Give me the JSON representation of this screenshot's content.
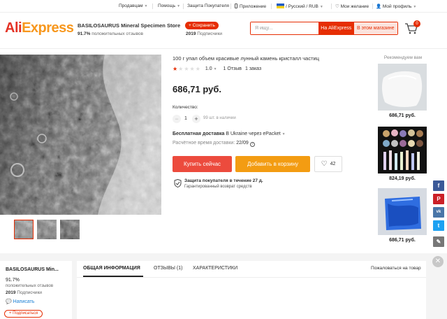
{
  "topbar": {
    "sellers": "Продавцам",
    "help": "Помощь",
    "buyer_protection": "Защита Покупателя",
    "app": "Приложение",
    "locale": "/ Русский / RUB",
    "wishlist": "Мои желание",
    "profile": "Мой профиль"
  },
  "header": {
    "logo_part1": "Ali",
    "logo_part2": "Express",
    "store_name": "BASILOSAURUS Mineral Specimen Store",
    "store_rating": "91.7%",
    "store_rating_label": "положительных отзывов",
    "save_button": "+ Сохранить",
    "subscribers_count": "2019",
    "subscribers_label": "Подписчики",
    "search_placeholder": "Я ищу...",
    "search_aliexpress": "На AliExpress",
    "search_store": "В этом магазине",
    "cart_count": "0"
  },
  "product": {
    "title": "100 г упал объем красивые лунный камень кристалл частиц",
    "rating_value": "1.0",
    "rating_stars": 1,
    "reviews": "1 Отзыв",
    "orders": "1 заказ",
    "price": "686,71 руб.",
    "quantity_label": "Количество:",
    "quantity": "1",
    "availability": "99 шт. в наличии",
    "shipping_bold": "Бесплатная доставка",
    "shipping_rest": " В Ukraine через ePacket",
    "delivery_label": "Расчётное время доставки:",
    "delivery_date": "22/09",
    "buy_now": "Купить сейчас",
    "add_to_cart": "Добавить в корзину",
    "wishlist_count": "42",
    "protection_title": "Защита покупателя в течение 27 д.",
    "protection_subtitle": "Гарантированный возврат средств"
  },
  "recommendations": {
    "title": "Рекомендуем вам",
    "items": [
      {
        "price": "686,71 руб."
      },
      {
        "price": "824,19 руб."
      },
      {
        "price": "686,71 руб."
      }
    ]
  },
  "share": {
    "facebook": "f",
    "pinterest": "P",
    "vk": "vk",
    "twitter": "t",
    "edit": "✎",
    "facebook_color": "#3b5998",
    "pinterest_color": "#cb2027",
    "vk_color": "#4a76a8",
    "twitter_color": "#1da1f2",
    "edit_color": "#777777"
  },
  "store_card": {
    "name": "BASILOSAURUS Min...",
    "rating": "91.7%",
    "rating_label": "положительных отзывов",
    "subscribers_count": "2019",
    "subscribers_label": "Подписчики",
    "write": "Написать",
    "follow": "+ Подписаться"
  },
  "tabs": {
    "overview": "ОБЩАЯ ИНФОРМАЦИЯ",
    "reviews": "ОТЗЫВЫ (1)",
    "specs": "ХАРАКТЕРИСТИКИ",
    "complain": "Пожаловаться на товар"
  },
  "colors": {
    "accent": "#e62e04",
    "buy": "#ec4b3d",
    "cart": "#f39c12"
  }
}
